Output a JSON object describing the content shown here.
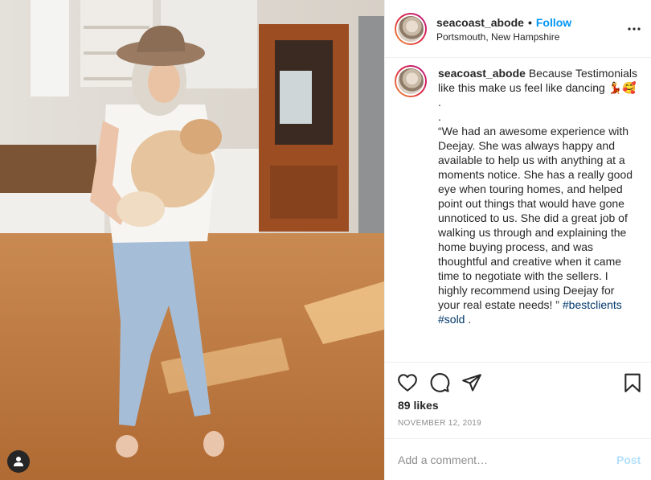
{
  "post": {
    "username": "seacoast_abode",
    "dot": "•",
    "follow_label": "Follow",
    "location": "Portsmouth, New Hampshire",
    "caption_text": " Because Testimonials like this make us feel like dancing 💃🥰\n.\n.\n“We had an awesome experience with Deejay. She was always happy and available to help us with anything at a moments notice. She has a really good eye when touring homes, and helped point out things that would have gone unnoticed to us. She did a great job of walking us through and explaining the home buying process, and was thoughtful and creative when it came time to negotiate with the sellers. I highly recommend using Deejay for your real estate needs! ” ",
    "hashtags": [
      "#bestclients",
      "#sold"
    ],
    "tag_separator": "\n",
    "caption_end": " .",
    "likes": "89 likes",
    "date": "NOVEMBER 12, 2019",
    "comment_placeholder": "Add a comment…",
    "post_label": "Post"
  },
  "icons": {
    "more": "more-options-icon",
    "like": "heart-icon",
    "comment": "comment-icon",
    "share": "paper-plane-icon",
    "save": "bookmark-icon",
    "tags": "user-tag-icon"
  },
  "colors": {
    "accent": "#0095f6",
    "hashtag": "#00376b",
    "muted": "#8e8e8e",
    "post_disabled": "#b2dffc",
    "border": "#efefef"
  }
}
